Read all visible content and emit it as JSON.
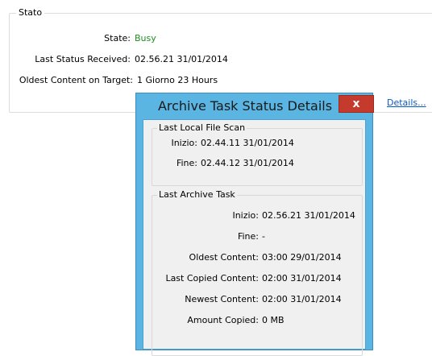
{
  "stato": {
    "title": "Stato",
    "state_label": "State:",
    "state_value": "Busy",
    "last_status_label": "Last Status Received:",
    "last_status_value": "02.56.21 31/01/2014",
    "oldest_label": "Oldest Content on Target:",
    "oldest_value": "1 Giorno 23 Hours",
    "details_link": "Details..."
  },
  "dialog": {
    "title": "Archive Task Status Details",
    "close_glyph": "x",
    "last_local_file_scan": {
      "title": "Last Local File Scan",
      "inizio_label": "Inizio:",
      "inizio_value": "02.44.11 31/01/2014",
      "fine_label": "Fine:",
      "fine_value": "02.44.12 31/01/2014"
    },
    "last_archive_task": {
      "title": "Last Archive Task",
      "rows": [
        {
          "label": "Inizio:",
          "value": "02.56.21 31/01/2014"
        },
        {
          "label": "Fine:",
          "value": "-"
        },
        {
          "label": "Oldest Content:",
          "value": "03:00 29/01/2014"
        },
        {
          "label": "Last Copied Content:",
          "value": "02:00 31/01/2014"
        },
        {
          "label": "Newest Content:",
          "value": "02:00 31/01/2014"
        },
        {
          "label": "Amount Copied:",
          "value": "0 MB"
        }
      ]
    }
  },
  "colors": {
    "state_busy": "#1e8f1e",
    "dialog_frame": "#5ab5e2",
    "close_button": "#c43b2e",
    "link": "#0b58c6"
  }
}
